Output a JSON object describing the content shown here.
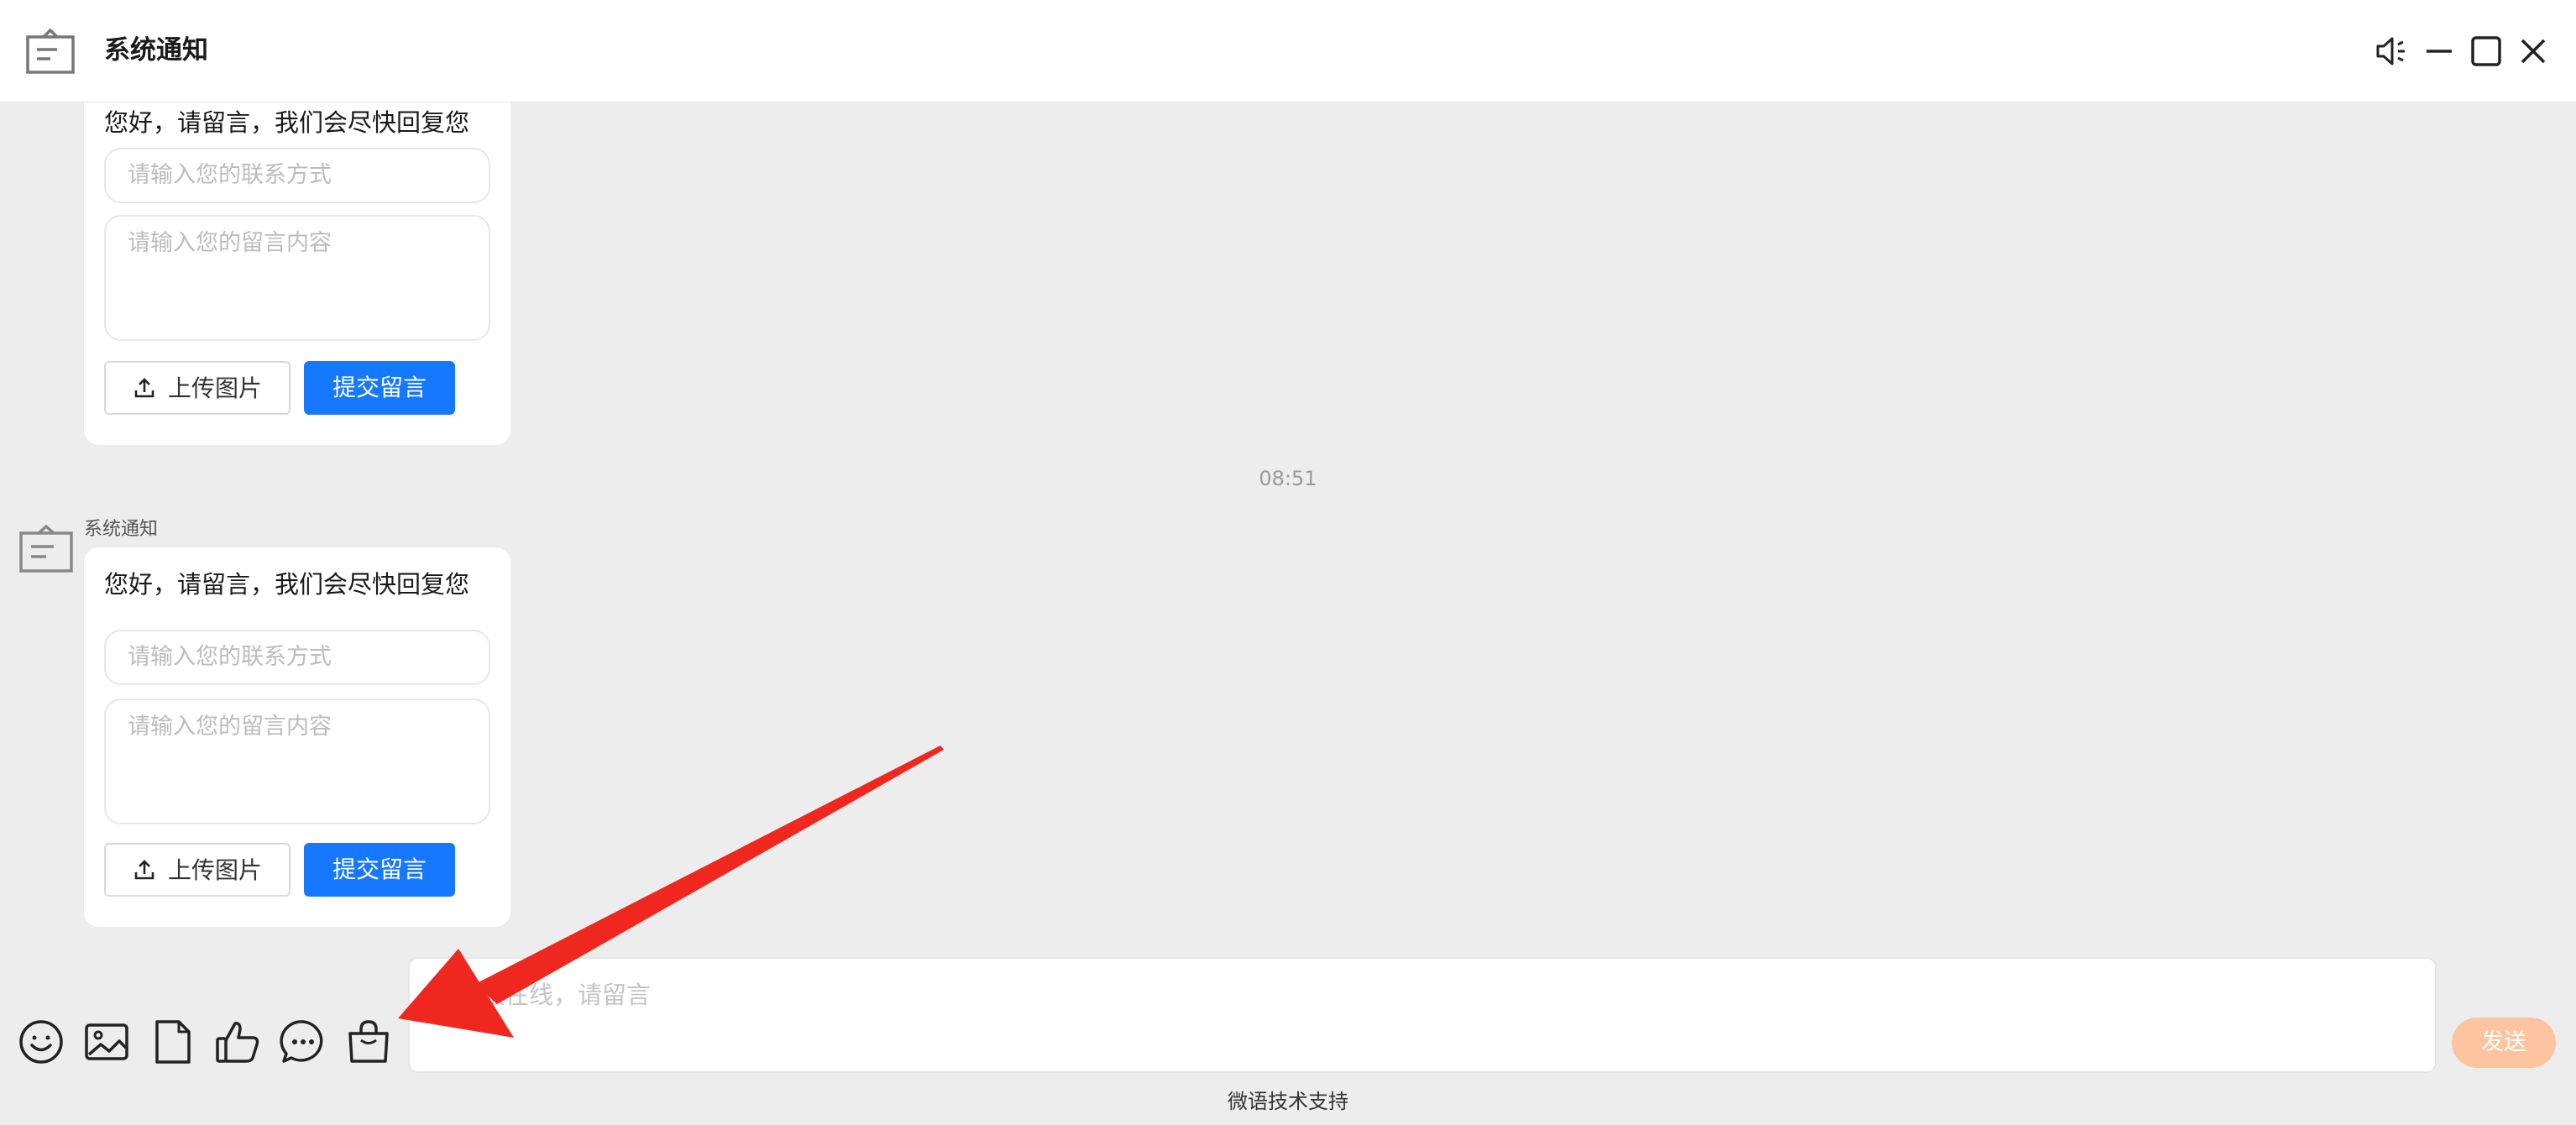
{
  "window": {
    "title": "系统通知",
    "controls": [
      "speaker-mute-icon",
      "minimize-icon",
      "maximize-icon",
      "close-icon"
    ]
  },
  "messages": [
    {
      "text": "您好，请留言，我们会尽快回复您",
      "contact_placeholder": "请输入您的联系方式",
      "content_placeholder": "请输入您的留言内容",
      "upload_label": "上传图片",
      "submit_label": "提交留言"
    },
    {
      "time": "08:51",
      "sender": "系统通知",
      "text": "您好，请留言，我们会尽快回复您",
      "contact_placeholder": "请输入您的联系方式",
      "content_placeholder": "请输入您的留言内容",
      "upload_label": "上传图片",
      "submit_label": "提交留言"
    }
  ],
  "toolbar": {
    "icons": [
      "emoji-icon",
      "image-icon",
      "file-icon",
      "thumbs-up-icon",
      "chat-bubble-icon",
      "shopping-bag-icon"
    ]
  },
  "composer": {
    "placeholder": "服在线，请留言",
    "send_label": "发送"
  },
  "footer": {
    "text": "微语技术支持"
  },
  "colors": {
    "primary": "#1677ff",
    "send_disabled": "#fdc4a0",
    "chat_background": "#ededed",
    "annotation_arrow": "#f0271e"
  }
}
